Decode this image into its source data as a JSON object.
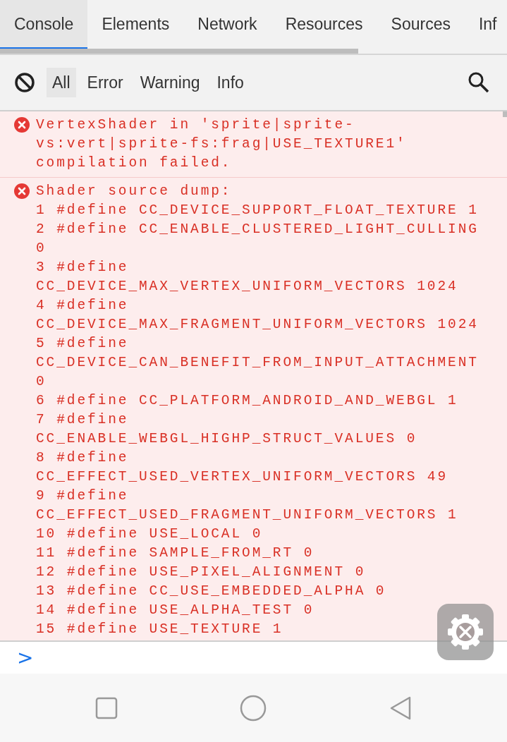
{
  "tabs": [
    {
      "label": "Console",
      "selected": true
    },
    {
      "label": "Elements",
      "selected": false
    },
    {
      "label": "Network",
      "selected": false
    },
    {
      "label": "Resources",
      "selected": false
    },
    {
      "label": "Sources",
      "selected": false
    },
    {
      "label": "Inf",
      "selected": false
    }
  ],
  "filters": [
    {
      "label": "All",
      "selected": true
    },
    {
      "label": "Error",
      "selected": false
    },
    {
      "label": "Warning",
      "selected": false
    },
    {
      "label": "Info",
      "selected": false
    }
  ],
  "messages": [
    {
      "kind": "error",
      "lines": [
        "VertexShader in 'sprite|sprite-",
        "vs:vert|sprite-fs:frag|USE_TEXTURE1'",
        "compilation failed."
      ]
    },
    {
      "kind": "error",
      "lines": [
        "Shader source dump:",
        "1 #define CC_DEVICE_SUPPORT_FLOAT_TEXTURE 1",
        "2 #define CC_ENABLE_CLUSTERED_LIGHT_CULLING",
        "0",
        "3 #define",
        "CC_DEVICE_MAX_VERTEX_UNIFORM_VECTORS 1024",
        "4 #define",
        "CC_DEVICE_MAX_FRAGMENT_UNIFORM_VECTORS 1024",
        "5 #define",
        "CC_DEVICE_CAN_BENEFIT_FROM_INPUT_ATTACHMENT",
        "0",
        "6 #define CC_PLATFORM_ANDROID_AND_WEBGL 1",
        "7 #define",
        "CC_ENABLE_WEBGL_HIGHP_STRUCT_VALUES 0",
        "8 #define",
        "CC_EFFECT_USED_VERTEX_UNIFORM_VECTORS 49",
        "9 #define",
        "CC_EFFECT_USED_FRAGMENT_UNIFORM_VECTORS 1",
        "10 #define USE_LOCAL 0",
        "11 #define SAMPLE_FROM_RT 0",
        "12 #define USE_PIXEL_ALIGNMENT 0",
        "13 #define CC_USE_EMBEDDED_ALPHA 0",
        "14 #define USE_ALPHA_TEST 0",
        "15 #define USE_TEXTURE 1"
      ]
    }
  ],
  "prompt": {
    "symbol": ">"
  }
}
